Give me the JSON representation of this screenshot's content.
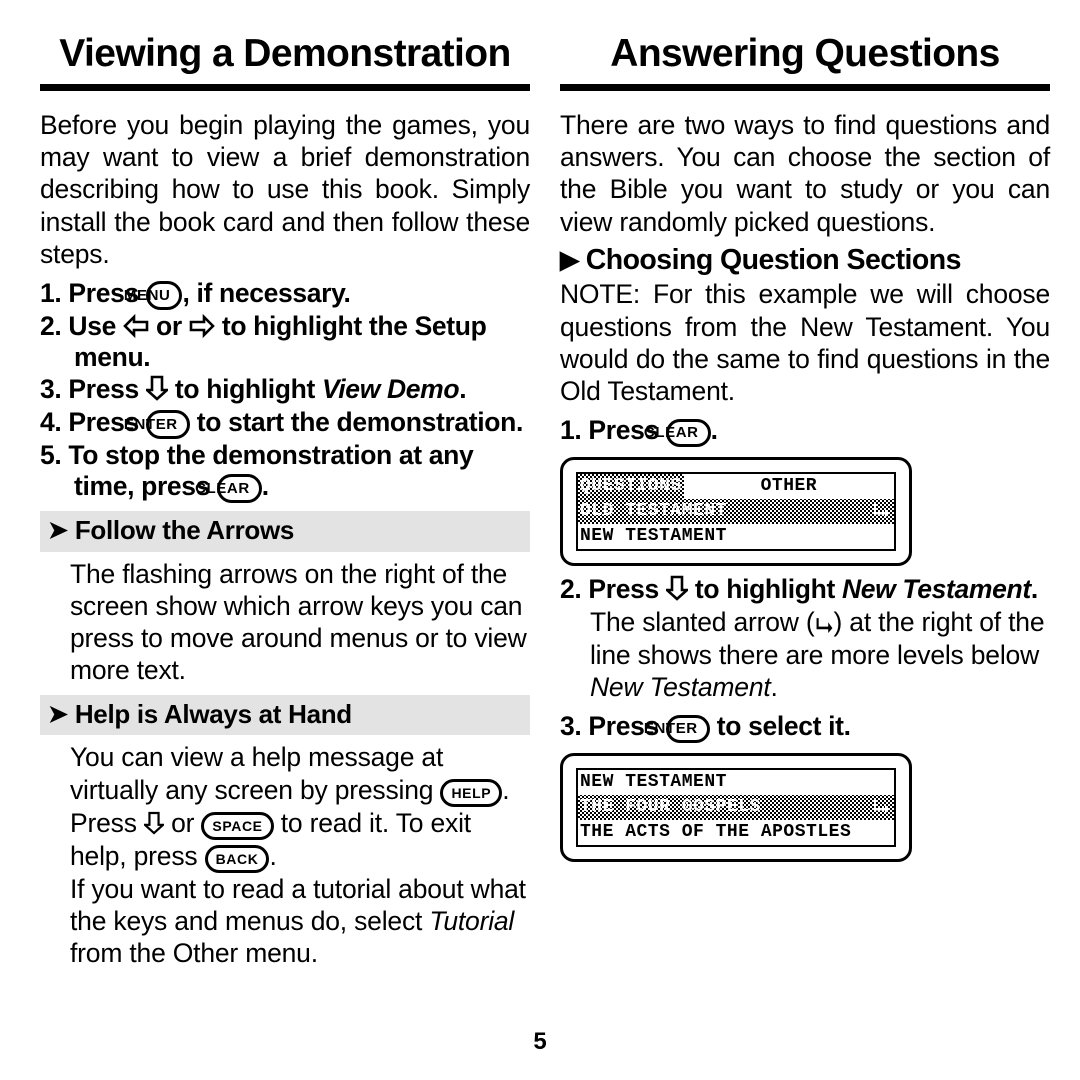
{
  "page_number": "5",
  "left_column": {
    "title": "Viewing a Demonstration",
    "intro": "Before you begin playing the games, you may want to view a brief demonstration describing how to use this book. Simply install the book card and then follow these steps.",
    "steps": [
      {
        "num": "1.",
        "before": "Press ",
        "key": "MENU",
        "after": ", if necessary."
      },
      {
        "num": "2.",
        "before": "Use ",
        "arrows": "left-right",
        "after": " to highlight the Setup menu."
      },
      {
        "num": "3.",
        "before": "Press ",
        "arrows": "down",
        "after_plain": " to highlight ",
        "italic": "View Demo",
        "tail": "."
      },
      {
        "num": "4.",
        "before": "Press ",
        "key": "ENTER",
        "after": " to start the demonstration."
      },
      {
        "num": "5.",
        "before": "To stop the demonstration at any time, press ",
        "key": "CLEAR",
        "after": "."
      }
    ],
    "section1": {
      "bullet": "arrow-bullet-icon",
      "heading": "Follow the Arrows",
      "body": "The flashing arrows on the right of the screen show which arrow keys you can press to move around menus or to view more text."
    },
    "section2": {
      "bullet": "arrow-bullet-icon",
      "heading": "Help is Always at Hand",
      "para1_key1": "HELP",
      "para1_a": ". Press ",
      "para1_arrow": "down-arrow-icon",
      "para1_b": " or ",
      "para1_key2": "SPACE",
      "para1_c": " to read it. To exit help, press ",
      "para1_key3": "BACK",
      "para1_d": ".",
      "para1_lead": "You can view a help message at virtually any screen by pressing ",
      "para2_a": "If you want to read a tutorial about what the keys and menus do, select ",
      "para2_italic": "Tutorial",
      "para2_b": " from the Other menu."
    }
  },
  "right_column": {
    "title": "Answering Questions",
    "intro": "There are two ways to find questions and answers. You can choose the section of the Bible you want to study or you can view randomly picked questions.",
    "section": {
      "bullet": "solid-triangle-icon",
      "heading": "Choosing Question Sections",
      "note": "NOTE: For this example we will choose questions from the New Testament. You would do the same to find questions in the Old Testament."
    },
    "steps": [
      {
        "num": "1.",
        "before": "Press ",
        "key": "CLEAR",
        "after": "."
      },
      {
        "num": "2.",
        "before": "Press ",
        "arrows": "down",
        "after_plain": " to highlight ",
        "italic": "New Testament",
        "tail": "."
      },
      {
        "num": "3.",
        "before": "Press ",
        "key": "ENTER",
        "after": " to select it."
      }
    ],
    "slant_para": {
      "a": "The slanted arrow (",
      "icon": "slanted-arrow-icon",
      "b": ") at the right of the line shows there are more levels below ",
      "italic": "New Testament",
      "c": "."
    },
    "lcd_screens": [
      {
        "name": "questions-menu-screen",
        "rows": [
          {
            "cells": [
              {
                "text": "QUESTIONS",
                "inverted": true
              },
              {
                "text": "OTHER",
                "inverted": false
              }
            ],
            "slant_arrow": false
          },
          {
            "cells": [
              {
                "text": "OLD TESTAMENT",
                "inverted": true
              }
            ],
            "full_inverted": true,
            "slant_arrow": true
          },
          {
            "cells": [
              {
                "text": "NEW TESTAMENT",
                "inverted": false
              }
            ],
            "slant_arrow": false
          }
        ]
      },
      {
        "name": "new-testament-menu-screen",
        "rows": [
          {
            "cells": [
              {
                "text": "NEW TESTAMENT",
                "inverted": false
              }
            ],
            "slant_arrow": false
          },
          {
            "cells": [
              {
                "text": "THE FOUR GOSPELS",
                "inverted": true
              }
            ],
            "full_inverted": true,
            "slant_arrow": true
          },
          {
            "cells": [
              {
                "text": "THE ACTS OF THE APOSTLES",
                "inverted": false
              }
            ],
            "slant_arrow": false
          }
        ]
      }
    ]
  },
  "colors": {
    "band_gray": "#e3e3e3",
    "ink": "#000000",
    "paper": "#ffffff"
  }
}
